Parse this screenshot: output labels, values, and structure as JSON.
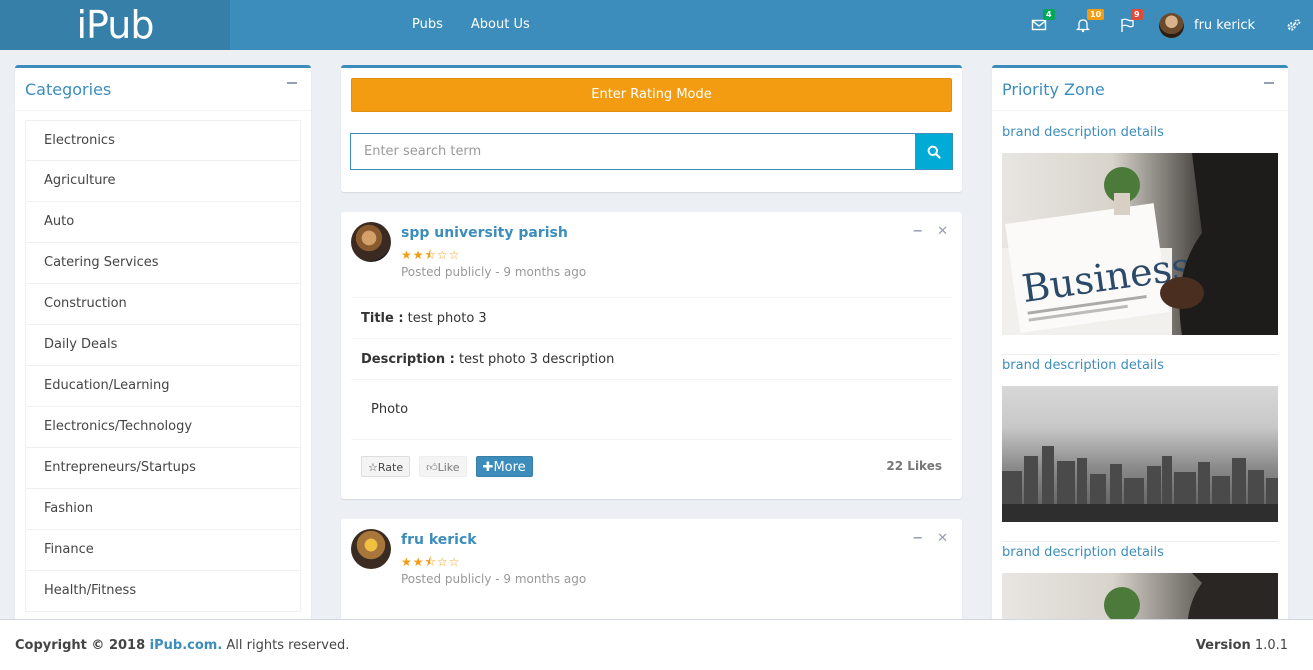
{
  "header": {
    "logo": "iPub",
    "nav": [
      "Pubs",
      "About Us"
    ],
    "badges": {
      "messages": "4",
      "notifications": "10",
      "flags": "9"
    },
    "user_name": "fru kerick"
  },
  "categories": {
    "title": "Categories",
    "items": [
      "Electronics",
      "Agriculture",
      "Auto",
      "Catering Services",
      "Construction",
      "Daily Deals",
      "Education/Learning",
      "Electronics/Technology",
      "Entrepreneurs/Startups",
      "Fashion",
      "Finance",
      "Health/Fitness"
    ]
  },
  "center": {
    "rating_button": "Enter Rating Mode",
    "search_placeholder": "Enter search term"
  },
  "posts": [
    {
      "name": "spp university parish",
      "stars": "★★⯪☆☆",
      "meta": "Posted publicly - 9 months ago",
      "title_label": "Title :",
      "title_value": " test photo 3",
      "desc_label": "Description :",
      "desc_value": " test photo 3 description",
      "media_label": "Photo",
      "rate": "Rate",
      "like": "Like",
      "more": "More",
      "likes": "22 Likes"
    },
    {
      "name": "fru kerick",
      "stars": "★★⯪☆☆",
      "meta": "Posted publicly - 9 months ago"
    }
  ],
  "priority": {
    "title": "Priority Zone",
    "links": [
      "brand description details",
      "brand description details",
      "brand description details"
    ],
    "image_text": "Business"
  },
  "footer": {
    "copy_prefix": "Copyright © 2018 ",
    "copy_link": "iPub.com.",
    "copy_suffix": " All rights reserved.",
    "version_label": "Version",
    "version_value": " 1.0.1"
  },
  "colors": {
    "primary": "#3c8dbc",
    "warning": "#f39c12",
    "info": "#00acd6"
  }
}
